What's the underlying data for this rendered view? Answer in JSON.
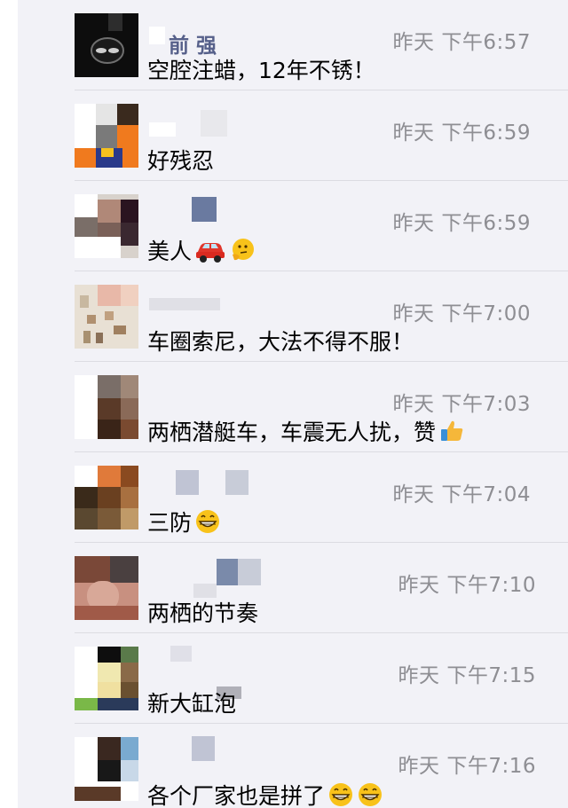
{
  "comments": [
    {
      "time": "昨天 下午6:57",
      "text": "空腔注蜡，12年不锈！",
      "nick_partial": "前  强",
      "emojis": []
    },
    {
      "time": "昨天 下午6:59",
      "text": "好残忍",
      "emojis": []
    },
    {
      "time": "昨天 下午6:59",
      "text": "美人",
      "emojis": [
        "car-icon",
        "thinking-face-icon"
      ]
    },
    {
      "time": "昨天 下午7:00",
      "text": "车圈索尼，大法不得不服！",
      "emojis": []
    },
    {
      "time": "昨天 下午7:03",
      "text": "两栖潜艇车，车震无人扰，赞",
      "emojis": [
        "thumbs-up-icon"
      ]
    },
    {
      "time": "昨天 下午7:04",
      "text": "三防",
      "emojis": [
        "grinning-face-icon"
      ]
    },
    {
      "time": "昨天 下午7:10",
      "text": "两栖的节奏",
      "emojis": []
    },
    {
      "time": "昨天 下午7:15",
      "text": "新大缸泡",
      "emojis": []
    },
    {
      "time": "昨天 下午7:16",
      "text": "各个厂家也是拼了",
      "emojis": [
        "grinning-face-icon",
        "grinning-face-icon"
      ]
    }
  ],
  "colors": {
    "panel_bg": "#f2f2f7",
    "time_text": "#8e8e93",
    "divider": "#dcdce2"
  }
}
